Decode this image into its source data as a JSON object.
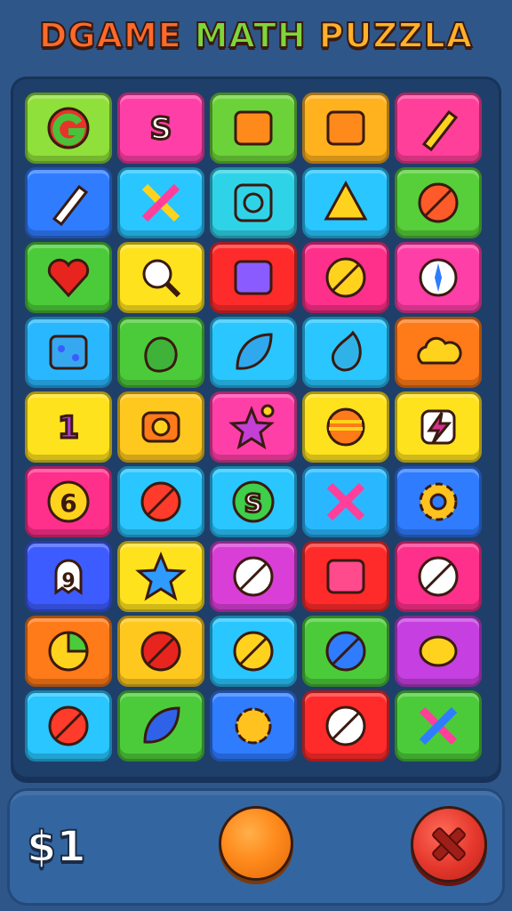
{
  "header": {
    "title_words": [
      {
        "text": "DGAME",
        "color": "#ff6a2b"
      },
      {
        "text": "MATH",
        "color": "#7ed63a"
      },
      {
        "text": "PUZZLA",
        "color": "#ffb12b"
      }
    ]
  },
  "board": {
    "rows": [
      [
        {
          "color": "#8fe03a",
          "icon": "g-letter-icon",
          "text": ""
        },
        {
          "color": "#ff3fa8",
          "icon": "s-letter-icon",
          "text": "S"
        },
        {
          "color": "#6cd23a",
          "icon": "orange-gear-box-icon",
          "text": ""
        },
        {
          "color": "#ffb21e",
          "icon": "rocket-card-icon",
          "text": ""
        },
        {
          "color": "#ff3f9a",
          "icon": "crayon-icon",
          "text": ""
        }
      ],
      [
        {
          "color": "#2f7cff",
          "icon": "rocket-icon",
          "text": ""
        },
        {
          "color": "#29c6ff",
          "icon": "crossed-arrows-icon",
          "text": ""
        },
        {
          "color": "#2fd3e8",
          "icon": "spiral-icon",
          "text": ""
        },
        {
          "color": "#29c6ff",
          "icon": "warning-triangle-icon",
          "text": ""
        },
        {
          "color": "#56cf3a",
          "icon": "leaf-ball-icon",
          "text": ""
        }
      ],
      [
        {
          "color": "#4ccb3a",
          "icon": "heart-icon",
          "text": ""
        },
        {
          "color": "#ffe21e",
          "icon": "search-icon",
          "text": ""
        },
        {
          "color": "#ff2b2b",
          "icon": "music-card-icon",
          "text": ""
        },
        {
          "color": "#ff2f8c",
          "icon": "striped-ball-icon",
          "text": ""
        },
        {
          "color": "#ff3fa8",
          "icon": "compass-icon",
          "text": ""
        }
      ],
      [
        {
          "color": "#29b8ff",
          "icon": "cheese-icon",
          "text": ""
        },
        {
          "color": "#4ccb3a",
          "icon": "green-blob-icon",
          "text": ""
        },
        {
          "color": "#29c6ff",
          "icon": "leaf-icon",
          "text": ""
        },
        {
          "color": "#29c6ff",
          "icon": "drop-icon",
          "text": ""
        },
        {
          "color": "#ff7a18",
          "icon": "cloud-icon",
          "text": ""
        }
      ],
      [
        {
          "color": "#ffe21e",
          "icon": "number-one-icon",
          "text": "1"
        },
        {
          "color": "#ffc81e",
          "icon": "camera-icon",
          "text": ""
        },
        {
          "color": "#ff3fa8",
          "icon": "star-pin-icon",
          "text": ""
        },
        {
          "color": "#ffe21e",
          "icon": "striped-sun-icon",
          "text": ""
        },
        {
          "color": "#ffe21e",
          "icon": "lightning-icon",
          "text": ""
        }
      ],
      [
        {
          "color": "#ff2f8c",
          "icon": "six-coin-icon",
          "text": "6"
        },
        {
          "color": "#29c6ff",
          "icon": "heart-leaf-icon",
          "text": ""
        },
        {
          "color": "#29c6ff",
          "icon": "s-badge-icon",
          "text": "S"
        },
        {
          "color": "#29b8ff",
          "icon": "cross-tools-icon",
          "text": ""
        },
        {
          "color": "#2f7cff",
          "icon": "gear-icon",
          "text": ""
        }
      ],
      [
        {
          "color": "#3d5cff",
          "icon": "ghost-icon",
          "text": "9"
        },
        {
          "color": "#ffe21e",
          "icon": "star-icon",
          "text": ""
        },
        {
          "color": "#d93fd6",
          "icon": "slash-ball-icon",
          "text": ""
        },
        {
          "color": "#ff2b2b",
          "icon": "flag-card-icon",
          "text": ""
        },
        {
          "color": "#ff2f8c",
          "icon": "pencil-ball-icon",
          "text": ""
        }
      ],
      [
        {
          "color": "#ff7a18",
          "icon": "pie-icon",
          "text": ""
        },
        {
          "color": "#ffc81e",
          "icon": "red-ball-icon",
          "text": ""
        },
        {
          "color": "#29c6ff",
          "icon": "rainbow-ball-icon",
          "text": ""
        },
        {
          "color": "#4ccb3a",
          "icon": "blue-ball-icon",
          "text": ""
        },
        {
          "color": "#c63fe0",
          "icon": "lemon-icon",
          "text": ""
        }
      ],
      [
        {
          "color": "#29c6ff",
          "icon": "beach-ball-icon",
          "text": ""
        },
        {
          "color": "#4ccb3a",
          "icon": "blue-leaf-icon",
          "text": ""
        },
        {
          "color": "#2f7cff",
          "icon": "yellow-flower-icon",
          "text": ""
        },
        {
          "color": "#ff2b2b",
          "icon": "white-ball-icon",
          "text": ""
        },
        {
          "color": "#4ccb3a",
          "icon": "scissors-icon",
          "text": ""
        }
      ]
    ]
  },
  "footer": {
    "score": "$1",
    "orange_button_icon": "orange-circle-icon",
    "close_button_icon": "close-icon"
  }
}
